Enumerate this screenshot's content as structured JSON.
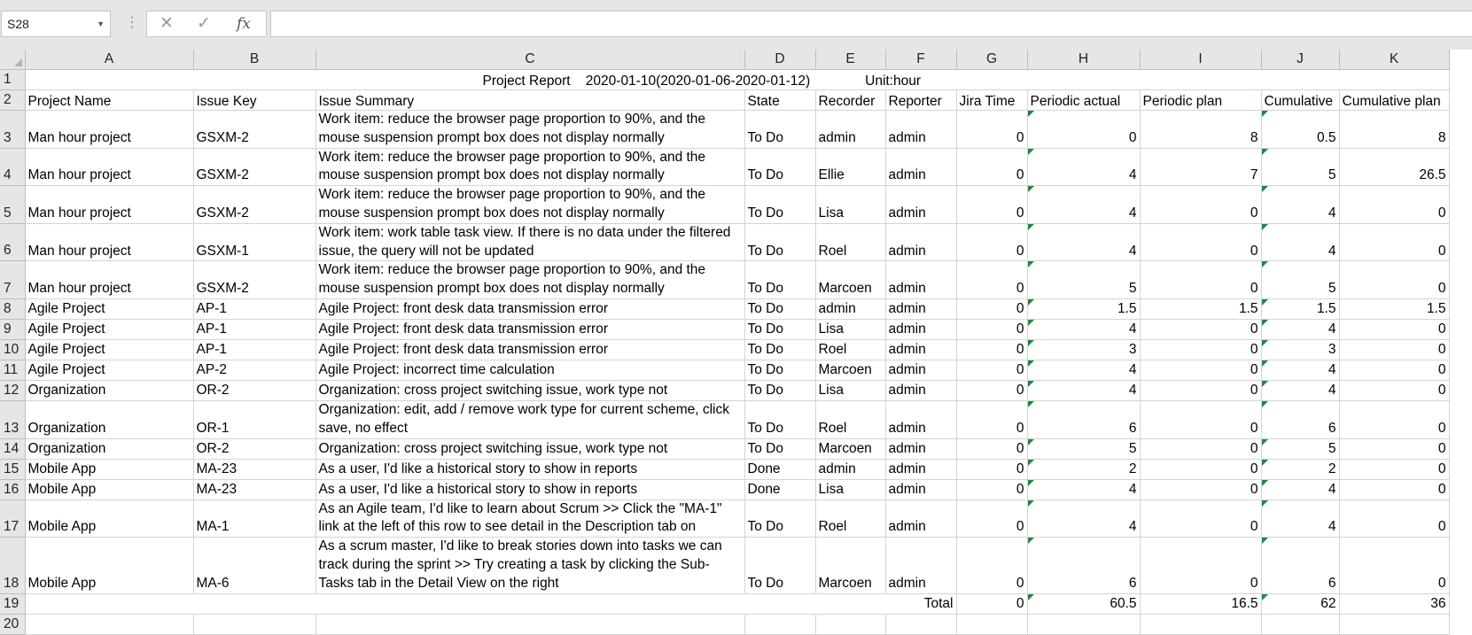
{
  "formula_bar": {
    "name_box": "S28",
    "cancel_icon": "✕",
    "enter_icon": "✓",
    "fx_label": "fx",
    "formula": ""
  },
  "columns": [
    "A",
    "B",
    "C",
    "D",
    "E",
    "F",
    "G",
    "H",
    "I",
    "J",
    "K"
  ],
  "title": {
    "text": "Project Report    2020-01-10(2020-01-06-2020-01-12)",
    "unit": "Unit:hour"
  },
  "headers": [
    "Project Name",
    "Issue Key",
    "Issue Summary",
    "State",
    "Recorder",
    "Reporter",
    "Jira Time",
    "Periodic actual",
    "Periodic plan",
    "Cumulative",
    "Cumulative plan"
  ],
  "rows": [
    {
      "num": "3",
      "project": "Man hour project",
      "key": "GSXM-2",
      "summary": "Work item: reduce the browser page proportion to 90%, and the mouse suspension prompt box does not display normally",
      "state": "To Do",
      "recorder": "admin",
      "reporter": "admin",
      "jira": "0",
      "pactual": "0",
      "pplan": "8",
      "cum": "0.5",
      "cplan": "8"
    },
    {
      "num": "4",
      "project": "Man hour project",
      "key": "GSXM-2",
      "summary": "Work item: reduce the browser page proportion to 90%, and the mouse suspension prompt box does not display normally",
      "state": "To Do",
      "recorder": "Ellie",
      "reporter": "admin",
      "jira": "0",
      "pactual": "4",
      "pplan": "7",
      "cum": "5",
      "cplan": "26.5"
    },
    {
      "num": "5",
      "project": "Man hour project",
      "key": "GSXM-2",
      "summary": "Work item: reduce the browser page proportion to 90%, and the mouse suspension prompt box does not display normally",
      "state": "To Do",
      "recorder": "Lisa",
      "reporter": "admin",
      "jira": "0",
      "pactual": "4",
      "pplan": "0",
      "cum": "4",
      "cplan": "0"
    },
    {
      "num": "6",
      "project": "Man hour project",
      "key": "GSXM-1",
      "summary": "Work item: work table task view. If there is no data under the filtered issue, the query will not be updated",
      "state": "To Do",
      "recorder": "Roel",
      "reporter": "admin",
      "jira": "0",
      "pactual": "4",
      "pplan": "0",
      "cum": "4",
      "cplan": "0"
    },
    {
      "num": "7",
      "project": "Man hour project",
      "key": "GSXM-2",
      "summary": "Work item: reduce the browser page proportion to 90%, and the mouse suspension prompt box does not display normally",
      "state": "To Do",
      "recorder": "Marcoen",
      "reporter": "admin",
      "jira": "0",
      "pactual": "5",
      "pplan": "0",
      "cum": "5",
      "cplan": "0"
    },
    {
      "num": "8",
      "project": "Agile Project",
      "key": "AP-1",
      "summary": "Agile Project: front desk data transmission error",
      "state": "To Do",
      "recorder": "admin",
      "reporter": "admin",
      "jira": "0",
      "pactual": "1.5",
      "pplan": "1.5",
      "cum": "1.5",
      "cplan": "1.5"
    },
    {
      "num": "9",
      "project": "Agile Project",
      "key": "AP-1",
      "summary": "Agile Project: front desk data transmission error",
      "state": "To Do",
      "recorder": "Lisa",
      "reporter": "admin",
      "jira": "0",
      "pactual": "4",
      "pplan": "0",
      "cum": "4",
      "cplan": "0"
    },
    {
      "num": "10",
      "project": "Agile Project",
      "key": "AP-1",
      "summary": "Agile Project: front desk data transmission error",
      "state": "To Do",
      "recorder": "Roel",
      "reporter": "admin",
      "jira": "0",
      "pactual": "3",
      "pplan": "0",
      "cum": "3",
      "cplan": "0"
    },
    {
      "num": "11",
      "project": "Agile Project",
      "key": "AP-2",
      "summary": "Agile Project: incorrect time calculation",
      "state": "To Do",
      "recorder": "Marcoen",
      "reporter": "admin",
      "jira": "0",
      "pactual": "4",
      "pplan": "0",
      "cum": "4",
      "cplan": "0"
    },
    {
      "num": "12",
      "project": "Organization",
      "key": "OR-2",
      "summary": "Organization: cross project switching issue, work type not",
      "state": "To Do",
      "recorder": "Lisa",
      "reporter": "admin",
      "jira": "0",
      "pactual": "4",
      "pplan": "0",
      "cum": "4",
      "cplan": "0"
    },
    {
      "num": "13",
      "project": "Organization",
      "key": "OR-1",
      "summary": "Organization: edit, add / remove work type for current scheme, click save, no effect",
      "state": "To Do",
      "recorder": "Roel",
      "reporter": "admin",
      "jira": "0",
      "pactual": "6",
      "pplan": "0",
      "cum": "6",
      "cplan": "0"
    },
    {
      "num": "14",
      "project": "Organization",
      "key": "OR-2",
      "summary": "Organization: cross project switching issue, work type not",
      "state": "To Do",
      "recorder": "Marcoen",
      "reporter": "admin",
      "jira": "0",
      "pactual": "5",
      "pplan": "0",
      "cum": "5",
      "cplan": "0"
    },
    {
      "num": "15",
      "project": "Mobile App",
      "key": "MA-23",
      "summary": "As a user, I'd like a historical story to show in reports",
      "state": "Done",
      "recorder": "admin",
      "reporter": "admin",
      "jira": "0",
      "pactual": "2",
      "pplan": "0",
      "cum": "2",
      "cplan": "0"
    },
    {
      "num": "16",
      "project": "Mobile App",
      "key": "MA-23",
      "summary": "As a user, I'd like a historical story to show in reports",
      "state": "Done",
      "recorder": "Lisa",
      "reporter": "admin",
      "jira": "0",
      "pactual": "4",
      "pplan": "0",
      "cum": "4",
      "cplan": "0"
    },
    {
      "num": "17",
      "project": "Mobile App",
      "key": "MA-1",
      "summary": "As an Agile team, I'd like to learn about Scrum >> Click the \"MA-1\" link at the left of this row to see detail in the Description tab on",
      "state": "To Do",
      "recorder": "Roel",
      "reporter": "admin",
      "jira": "0",
      "pactual": "4",
      "pplan": "0",
      "cum": "4",
      "cplan": "0"
    },
    {
      "num": "18",
      "project": "Mobile App",
      "key": "MA-6",
      "summary": "As a scrum master, I'd like to break stories down into tasks we can track during the sprint >> Try creating a task by clicking the Sub-Tasks tab in the Detail View on the right",
      "state": "To Do",
      "recorder": "Marcoen",
      "reporter": "admin",
      "jira": "0",
      "pactual": "6",
      "pplan": "0",
      "cum": "6",
      "cplan": "0"
    }
  ],
  "total": {
    "num": "19",
    "label": "Total",
    "jira": "0",
    "pactual": "60.5",
    "pplan": "16.5",
    "cum": "62",
    "cplan": "36"
  },
  "empty_row": {
    "num": "20"
  }
}
